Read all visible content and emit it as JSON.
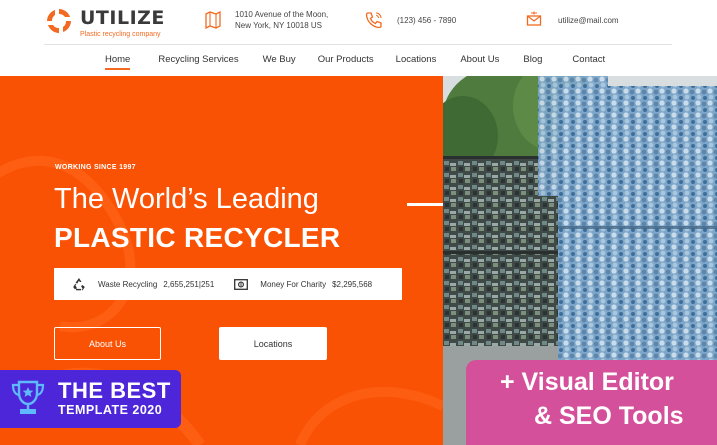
{
  "brand": {
    "name": "UTILIZE",
    "tagline": "Plastic recycling company",
    "accent_color": "#f26a21"
  },
  "contact": {
    "address_line1": "1010 Avenue of the Moon,",
    "address_line2": "New York, NY 10018 US",
    "address_icon": "map-icon",
    "phone": "(123) 456 - 7890",
    "phone_icon": "phone-icon",
    "email": "utilize@mail.com",
    "email_icon": "mail-icon"
  },
  "nav": {
    "items": [
      {
        "label": "Home",
        "active": true
      },
      {
        "label": "Recycling Services",
        "active": false
      },
      {
        "label": "We Buy",
        "active": false
      },
      {
        "label": "Our Products",
        "active": false
      },
      {
        "label": "Locations",
        "active": false
      },
      {
        "label": "About Us",
        "active": false
      },
      {
        "label": "Blog",
        "active": false
      },
      {
        "label": "Contact",
        "active": false
      }
    ]
  },
  "hero": {
    "background_color": "#fa5205",
    "eyebrow": "WORKING SINCE 1997",
    "title_line1": "The World’s Leading",
    "title_line2": "PLASTIC RECYCLER",
    "stats": [
      {
        "icon": "recycle-icon",
        "label": "Waste Recycling",
        "value": "2,655,251|251"
      },
      {
        "icon": "money-icon",
        "label": "Money For Charity",
        "value": "$2,295,568"
      }
    ],
    "buttons": {
      "about": "About Us",
      "locations": "Locations"
    }
  },
  "badge": {
    "icon": "trophy-icon",
    "line1": "THE BEST",
    "line2": "TEMPLATE 2020",
    "color": "#4d26d9"
  },
  "promo": {
    "line1": "+ Visual Editor",
    "line2": "& SEO Tools",
    "color": "#d4509a"
  }
}
